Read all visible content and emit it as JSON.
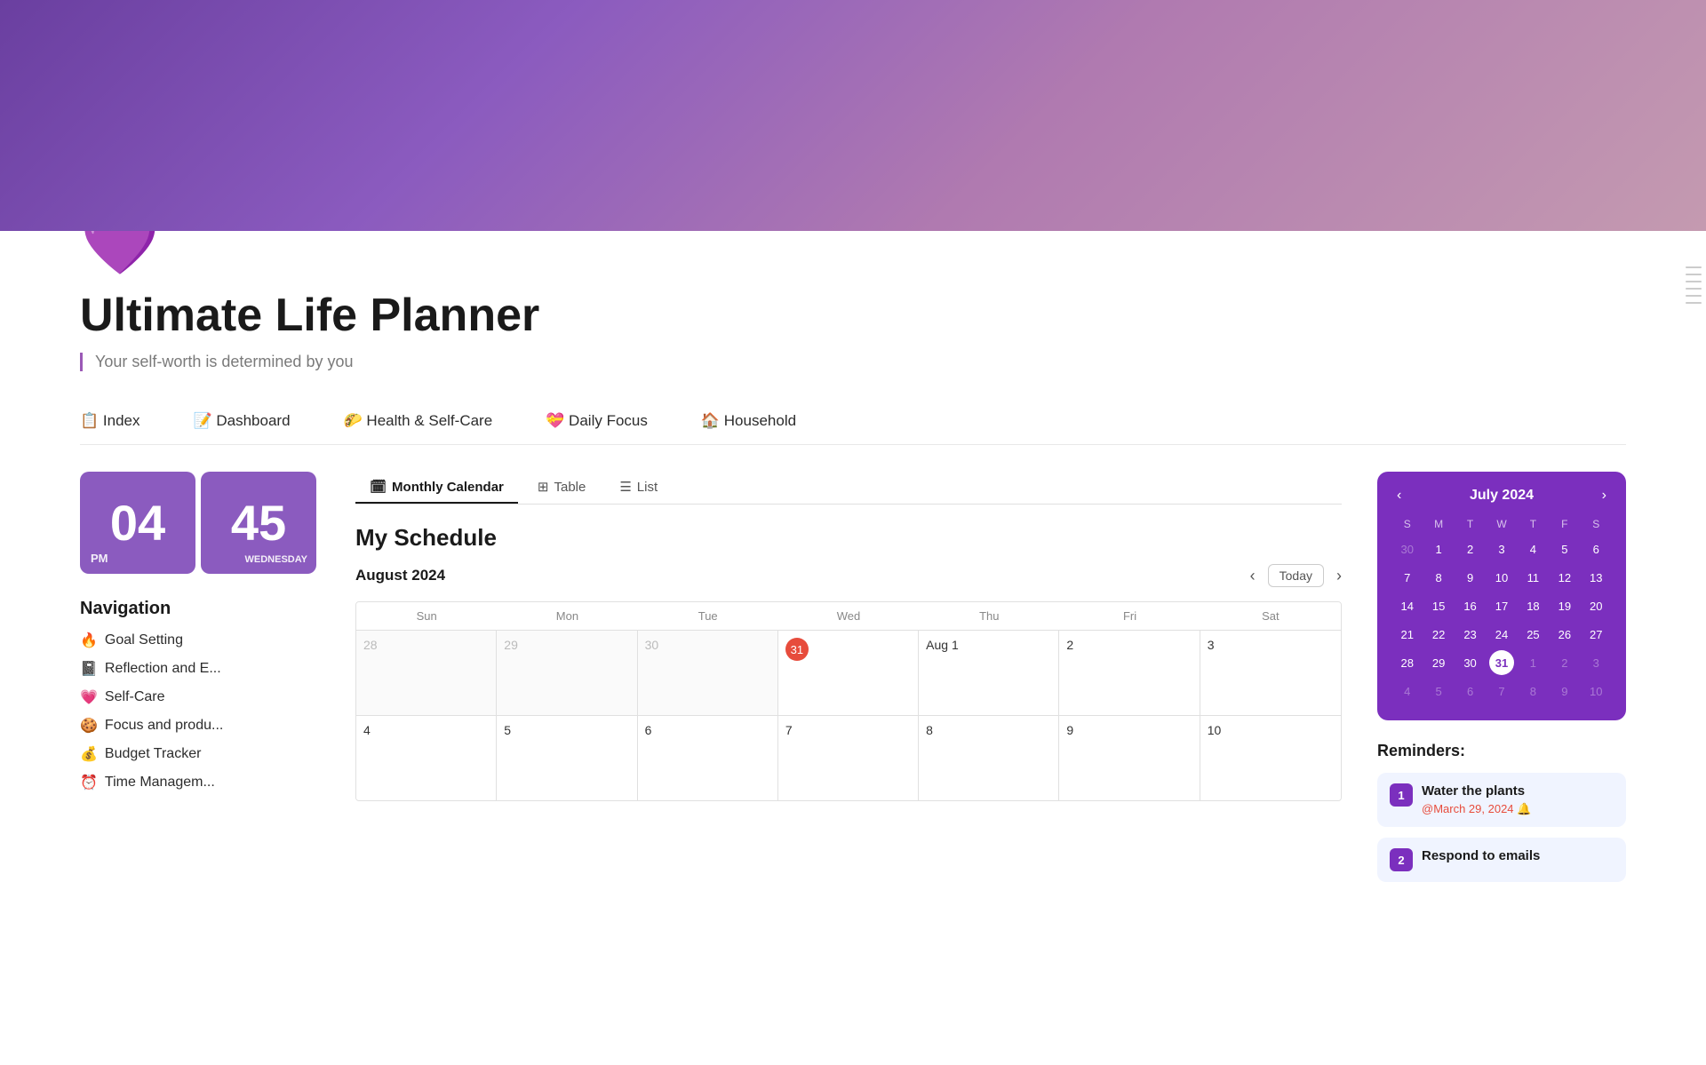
{
  "header": {
    "gradient_desc": "purple to pink gradient",
    "heart_emoji": "💜",
    "title": "Ultimate Life Planner",
    "subtitle": "Your self-worth is determined by you"
  },
  "nav": {
    "items": [
      {
        "label": "📋 Index",
        "key": "index"
      },
      {
        "label": "📝 Dashboard",
        "key": "dashboard"
      },
      {
        "label": "🌮 Health & Self-Care",
        "key": "health"
      },
      {
        "label": "💝 Daily Focus",
        "key": "daily-focus"
      },
      {
        "label": "🏠 Household",
        "key": "household"
      }
    ]
  },
  "clock": {
    "hour": "04",
    "minute": "45",
    "period": "PM",
    "day": "WEDNESDAY"
  },
  "navigation": {
    "title": "Navigation",
    "items": [
      {
        "emoji": "🔥",
        "label": "Goal Setting"
      },
      {
        "emoji": "📓",
        "label": "Reflection and E..."
      },
      {
        "emoji": "💗",
        "label": "Self-Care"
      },
      {
        "emoji": "🍪",
        "label": "Focus and produ..."
      },
      {
        "emoji": "💰",
        "label": "Budget Tracker"
      },
      {
        "emoji": "⏰",
        "label": "Time Managem..."
      }
    ]
  },
  "calendar_tabs": [
    {
      "label": "Monthly Calendar",
      "icon": "🗓",
      "active": true
    },
    {
      "label": "Table",
      "icon": "⊞",
      "active": false
    },
    {
      "label": "List",
      "icon": "☰",
      "active": false
    }
  ],
  "schedule": {
    "title": "My Schedule",
    "month": "August 2024",
    "today_btn": "Today",
    "day_labels": [
      "Sun",
      "Mon",
      "Tue",
      "Wed",
      "Thu",
      "Fri",
      "Sat"
    ],
    "weeks": [
      [
        {
          "date": "28",
          "type": "prev"
        },
        {
          "date": "29",
          "type": "prev"
        },
        {
          "date": "30",
          "type": "prev"
        },
        {
          "date": "31",
          "type": "today",
          "today": true
        },
        {
          "date": "Aug 1",
          "type": "current"
        },
        {
          "date": "2",
          "type": "current"
        },
        {
          "date": "3",
          "type": "current"
        }
      ],
      [
        {
          "date": "4",
          "type": "current"
        },
        {
          "date": "5",
          "type": "current"
        },
        {
          "date": "6",
          "type": "current"
        },
        {
          "date": "7",
          "type": "current"
        },
        {
          "date": "8",
          "type": "current"
        },
        {
          "date": "9",
          "type": "current"
        },
        {
          "date": "10",
          "type": "current"
        }
      ]
    ]
  },
  "mini_calendar": {
    "title": "July 2024",
    "day_labels": [
      "S",
      "M",
      "T",
      "W",
      "T",
      "F",
      "S"
    ],
    "weeks": [
      [
        {
          "date": "30",
          "faded": true
        },
        {
          "date": "1",
          "faded": false
        },
        {
          "date": "2",
          "faded": false
        },
        {
          "date": "3",
          "faded": false
        },
        {
          "date": "4",
          "faded": false
        },
        {
          "date": "5",
          "faded": false
        },
        {
          "date": "6",
          "faded": false
        }
      ],
      [
        {
          "date": "7",
          "faded": false
        },
        {
          "date": "8",
          "faded": false
        },
        {
          "date": "9",
          "faded": false
        },
        {
          "date": "10",
          "faded": false
        },
        {
          "date": "11",
          "faded": false
        },
        {
          "date": "12",
          "faded": false
        },
        {
          "date": "13",
          "faded": false
        }
      ],
      [
        {
          "date": "14",
          "faded": false
        },
        {
          "date": "15",
          "faded": false
        },
        {
          "date": "16",
          "faded": false
        },
        {
          "date": "17",
          "faded": false
        },
        {
          "date": "18",
          "faded": false
        },
        {
          "date": "19",
          "faded": false
        },
        {
          "date": "20",
          "faded": false
        }
      ],
      [
        {
          "date": "21",
          "faded": false
        },
        {
          "date": "22",
          "faded": false
        },
        {
          "date": "23",
          "faded": false
        },
        {
          "date": "24",
          "faded": false
        },
        {
          "date": "25",
          "faded": false
        },
        {
          "date": "26",
          "faded": false
        },
        {
          "date": "27",
          "faded": false
        }
      ],
      [
        {
          "date": "28",
          "faded": false
        },
        {
          "date": "29",
          "faded": false
        },
        {
          "date": "30",
          "faded": false
        },
        {
          "date": "31",
          "faded": false,
          "today": true
        },
        {
          "date": "1",
          "faded": true
        },
        {
          "date": "2",
          "faded": true
        },
        {
          "date": "3",
          "faded": true
        }
      ],
      [
        {
          "date": "4",
          "faded": true
        },
        {
          "date": "5",
          "faded": true
        },
        {
          "date": "6",
          "faded": true
        },
        {
          "date": "7",
          "faded": true
        },
        {
          "date": "8",
          "faded": true
        },
        {
          "date": "9",
          "faded": true
        },
        {
          "date": "10",
          "faded": true
        }
      ]
    ]
  },
  "reminders": {
    "title": "Reminders:",
    "items": [
      {
        "num": "1",
        "text": "Water the plants",
        "date": "@March 29, 2024 🔔"
      },
      {
        "num": "2",
        "text": "Respond to emails",
        "date": ""
      }
    ]
  }
}
